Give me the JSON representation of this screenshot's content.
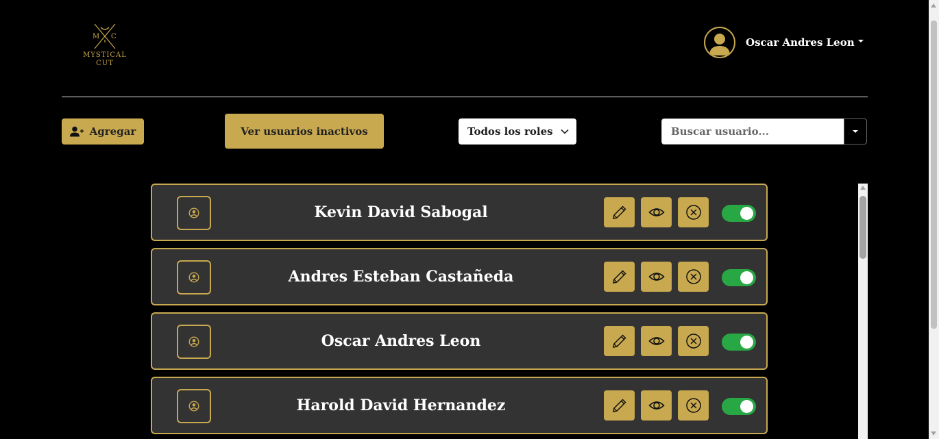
{
  "brand": {
    "monogram_left": "M",
    "monogram_right": "C",
    "name_line1": "MYSTICAL",
    "name_line2": "CUT",
    "accent_color": "#c9a94f"
  },
  "user_menu": {
    "name": "Oscar Andres Leon",
    "avatar_icon": "user-avatar-icon",
    "dropdown_icon": "caret-down-icon"
  },
  "toolbar": {
    "add_label": "Agregar",
    "add_icon": "user-plus-icon",
    "inactive_label": "Ver usuarios inactivos",
    "role_filter_value": "Todos los roles",
    "search_placeholder": "Buscar usuario..."
  },
  "users": [
    {
      "name": "Kevin David Sabogal",
      "active": true
    },
    {
      "name": "Andres Esteban Castañeda",
      "active": true
    },
    {
      "name": "Oscar Andres Leon",
      "active": true
    },
    {
      "name": "Harold David Hernandez",
      "active": true
    }
  ],
  "row_actions": {
    "edit_icon": "pencil-icon",
    "view_icon": "eye-icon",
    "delete_icon": "circle-x-icon",
    "toggle_color": "#28a745"
  }
}
